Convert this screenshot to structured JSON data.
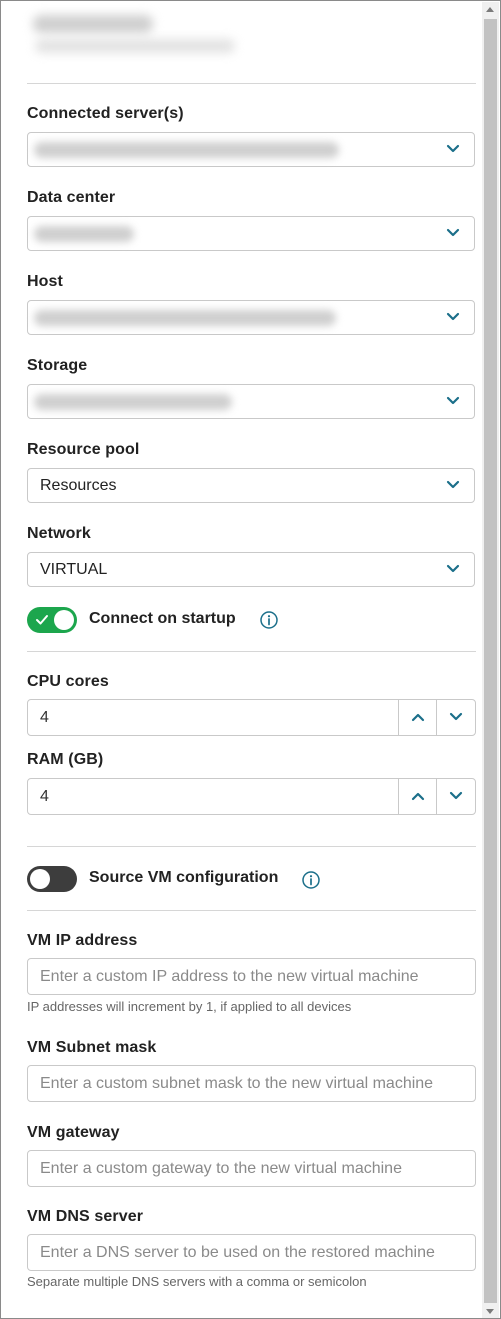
{
  "form": {
    "connected_servers": {
      "label": "Connected server(s)"
    },
    "data_center": {
      "label": "Data center"
    },
    "host": {
      "label": "Host"
    },
    "storage": {
      "label": "Storage"
    },
    "resource_pool": {
      "label": "Resource pool",
      "value": "Resources"
    },
    "network": {
      "label": "Network",
      "value": "VIRTUAL"
    },
    "connect_on_startup": {
      "label": "Connect on startup",
      "enabled": true
    },
    "cpu_cores": {
      "label": "CPU cores",
      "value": "4"
    },
    "ram": {
      "label": "RAM (GB)",
      "value": "4"
    },
    "source_vm_config": {
      "label": "Source VM configuration",
      "enabled": false
    },
    "vm_ip": {
      "label": "VM IP address",
      "placeholder": "Enter a custom IP address to the new virtual machine",
      "hint": "IP addresses will increment by 1, if applied to all devices"
    },
    "vm_subnet": {
      "label": "VM Subnet mask",
      "placeholder": "Enter a custom subnet mask to the new virtual machine"
    },
    "vm_gateway": {
      "label": "VM gateway",
      "placeholder": "Enter a custom gateway to the new virtual machine"
    },
    "vm_dns": {
      "label": "VM DNS server",
      "placeholder": "Enter a DNS server to be used on the restored machine",
      "hint": "Separate multiple DNS servers with a comma or semicolon"
    }
  },
  "colors": {
    "accent": "#1ca64d",
    "chevron": "#1b6f8a",
    "toggle_off": "#3d3d3d"
  },
  "icons": [
    "chevron-down-icon",
    "chevron-up-icon",
    "info-icon",
    "check-icon"
  ]
}
